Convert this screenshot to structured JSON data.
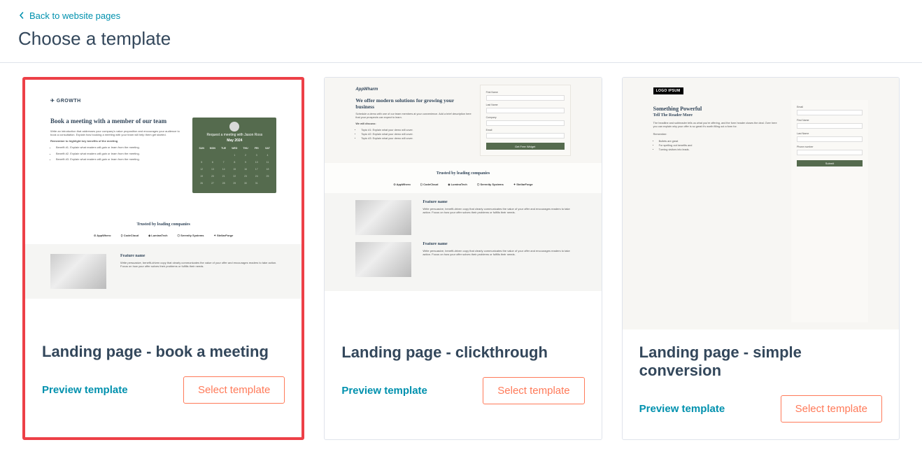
{
  "header": {
    "back_label": "Back to website pages",
    "page_title": "Choose a template"
  },
  "templates": [
    {
      "name": "Landing page - book a meeting",
      "preview_label": "Preview template",
      "select_label": "Select template"
    },
    {
      "name": "Landing page - clickthrough",
      "preview_label": "Preview template",
      "select_label": "Select template"
    },
    {
      "name": "Landing page - simple conversion",
      "preview_label": "Preview template",
      "select_label": "Select template"
    }
  ],
  "thumb1": {
    "logo": "✈ GROWTH",
    "heading": "Book a meeting with a member of our team",
    "intro": "Write an introduction that addresses your company's value proposition and encourages your audience to book a consultation. Explain how booking a meeting with your team will help them get started.",
    "bold_line": "Remember to highlight key benefits of the meeting",
    "benefits": [
      "Benefit #1. Explain what readers will gain or learn from the meeting.",
      "Benefit #2. Explain what readers will gain or learn from the meeting.",
      "Benefit #3. Explain what readers will gain or learn from the meeting."
    ],
    "cal_title": "Request a meeting with Jason Ross",
    "cal_month": "May 2024",
    "cal_days": [
      "SUN",
      "MON",
      "TUE",
      "WED",
      "THU",
      "FRI",
      "SAT"
    ],
    "trusted": "Trusted by leading companies",
    "logos": [
      "⊙ AppWhero",
      "⟨⟩ CodeCloud",
      "◈ LuminaTech",
      "⬡ Serenity Systems",
      "✦ StellarForge"
    ],
    "feature_name": "Feature name",
    "feature_text": "Write persuasive, benefit-driven copy that clearly communicates the value of your offer and encourages readers to take action. Focus on how your offer solves their problems or fulfills their needs."
  },
  "thumb2": {
    "logo": "AppWharm",
    "heading": "We offer modern solutions for growing your business",
    "intro": "Schedule a demo with one of our team members at your convenience. Add a brief description here that your prospects can expect to learn.",
    "discuss_label": "We will discuss:",
    "topics": [
      "Topic #1: Explain what your demo will cover.",
      "Topic #2: Explain what your demo will cover.",
      "Topic #3: Explain what your demo will cover."
    ],
    "form_labels": [
      "First Name",
      "Last Name",
      "Company",
      "Email"
    ],
    "form_btn": "Get Free Widget",
    "trusted": "Trusted by leading companies",
    "logos": [
      "⊙ AppWhero",
      "⟨⟩ CodeCloud",
      "◈ LuminaTech",
      "⬡ Serenity Systems",
      "✦ StellarForge"
    ],
    "feature_name": "Feature name",
    "feature_text": "Write persuasive, benefit-driven copy that clearly communicates the value of your offer and encourages readers to take action. Focus on how your offer solves their problems or fulfills their needs."
  },
  "thumb3": {
    "logo": "LOGO IPSUM",
    "heading": "Something Powerful",
    "subheading": "Tell The Reader More",
    "intro": "The headline and subheader tells us what you're offering, and the form header closes the deal. Over here you can explain why your offer is so great it's worth filling out a form for.",
    "remember": "Remember:",
    "bullets": [
      "Bullets are great",
      "For spelling out benefits and",
      "Turning visitors into leads."
    ],
    "form_labels": [
      "Email",
      "First Name",
      "Last Name",
      "Phone number"
    ],
    "form_btn": "Submit"
  }
}
